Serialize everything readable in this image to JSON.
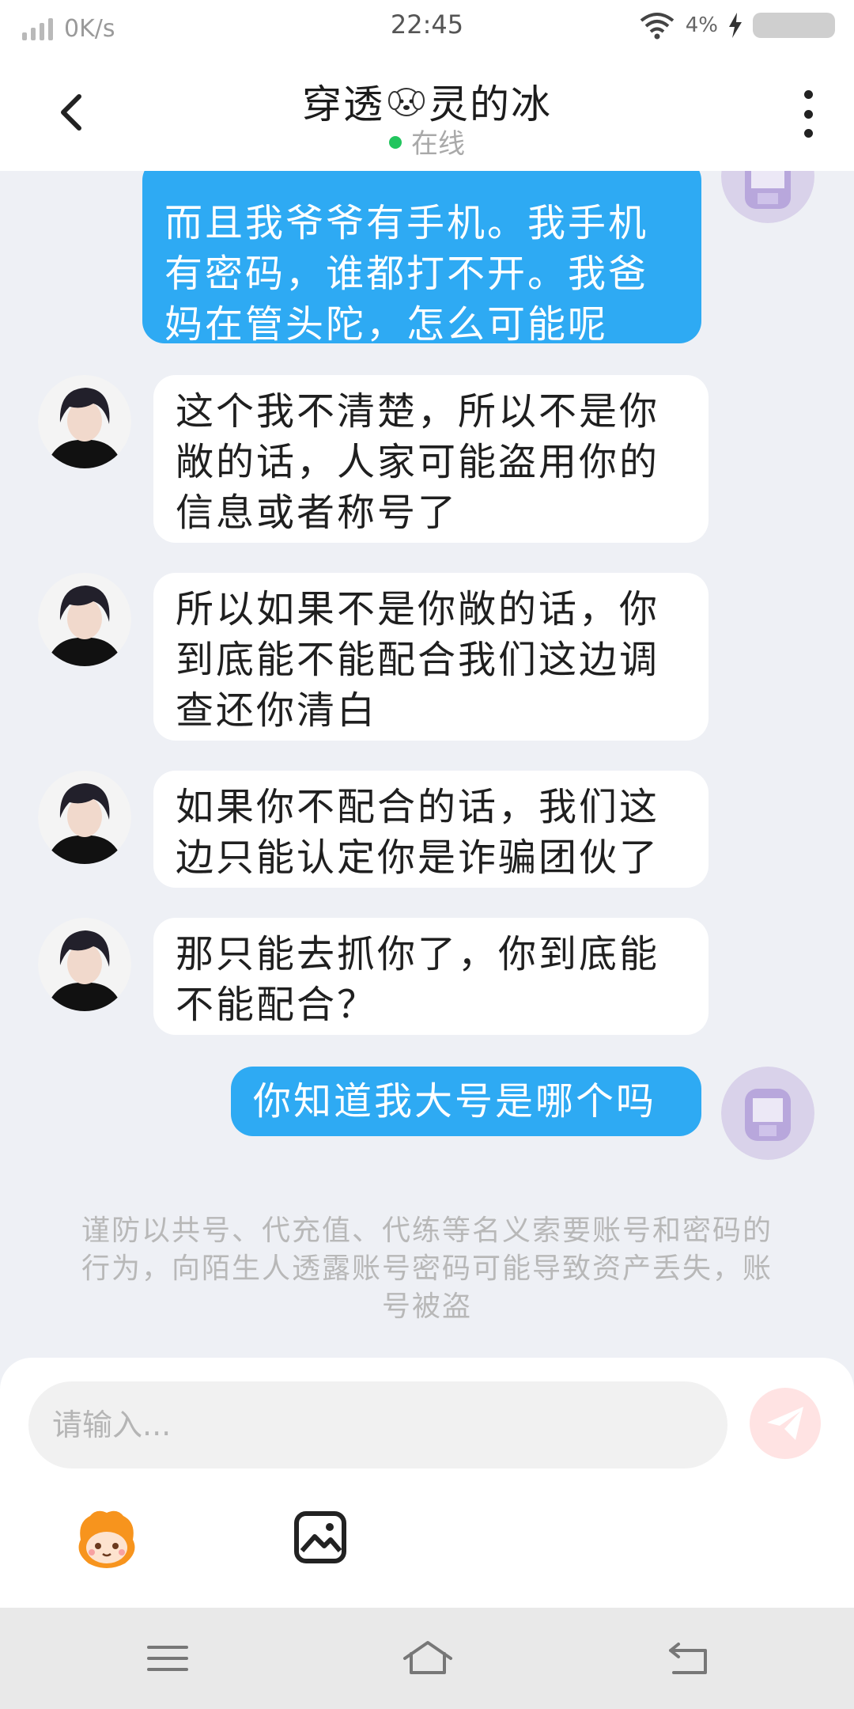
{
  "status_bar": {
    "speed": "0K/s",
    "time": "22:45",
    "battery_pct": "4%"
  },
  "header": {
    "title_part1": "穿透",
    "title_part2": "灵的冰",
    "status": "在线"
  },
  "messages": [
    {
      "sender": "me",
      "text": "而且我爷爷有手机。我手机有密码，谁都打不开。我爸妈在管头陀，怎么可能呢"
    },
    {
      "sender": "them",
      "text": "这个我不清楚，所以不是你敞的话，人家可能盗用你的信息或者称号了"
    },
    {
      "sender": "them",
      "text": "所以如果不是你敞的话，你到底能不能配合我们这边调查还你清白"
    },
    {
      "sender": "them",
      "text": "如果你不配合的话，我们这边只能认定你是诈骗团伙了"
    },
    {
      "sender": "them",
      "text": "那只能去抓你了，你到底能不能配合？"
    },
    {
      "sender": "me",
      "text": "你知道我大号是哪个吗"
    }
  ],
  "notice": "谨防以共号、代充值、代练等名义索要账号和密码的行为，向陌生人透露账号密码可能导致资产丢失，账号被盗",
  "input": {
    "placeholder": "请输入..."
  },
  "colors": {
    "my_bubble": "#2eaaf3",
    "their_bubble": "#ffffff",
    "online_dot": "#22c55e",
    "background": "#eef0f5"
  },
  "icons": [
    "back-icon",
    "more-icon",
    "send-icon",
    "emoji-mascot-icon",
    "image-icon",
    "menu-icon",
    "home-icon",
    "back-nav-icon"
  ]
}
